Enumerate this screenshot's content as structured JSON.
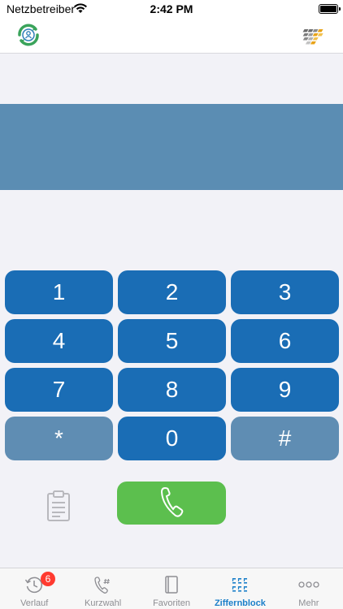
{
  "status_bar": {
    "carrier": "Netzbetreiber",
    "time": "2:42 PM"
  },
  "nav_bar": {
    "left_icon": "contact-sync-icon",
    "right_icon": "app-logo-icon"
  },
  "display": {
    "number": ""
  },
  "keypad": {
    "keys": [
      "1",
      "2",
      "3",
      "4",
      "5",
      "6",
      "7",
      "8",
      "9",
      "*",
      "0",
      "#"
    ]
  },
  "actions": {
    "paste_icon": "clipboard-icon",
    "call_icon": "phone-icon"
  },
  "tab_bar": {
    "tabs": [
      {
        "label": "Verlauf",
        "icon": "history-icon",
        "badge": "6"
      },
      {
        "label": "Kurzwahl",
        "icon": "speed-dial-icon"
      },
      {
        "label": "Favoriten",
        "icon": "favorites-icon"
      },
      {
        "label": "Ziffernblock",
        "icon": "keypad-grid-icon",
        "active": true
      },
      {
        "label": "Mehr",
        "icon": "more-icon"
      }
    ]
  },
  "colors": {
    "key_primary": "#1a6db5",
    "key_secondary": "#5f8db3",
    "display_background": "#5b8db3",
    "call_green": "#5cbf4e",
    "tab_active": "#1a7fc9",
    "badge_red": "#ff3b30"
  }
}
